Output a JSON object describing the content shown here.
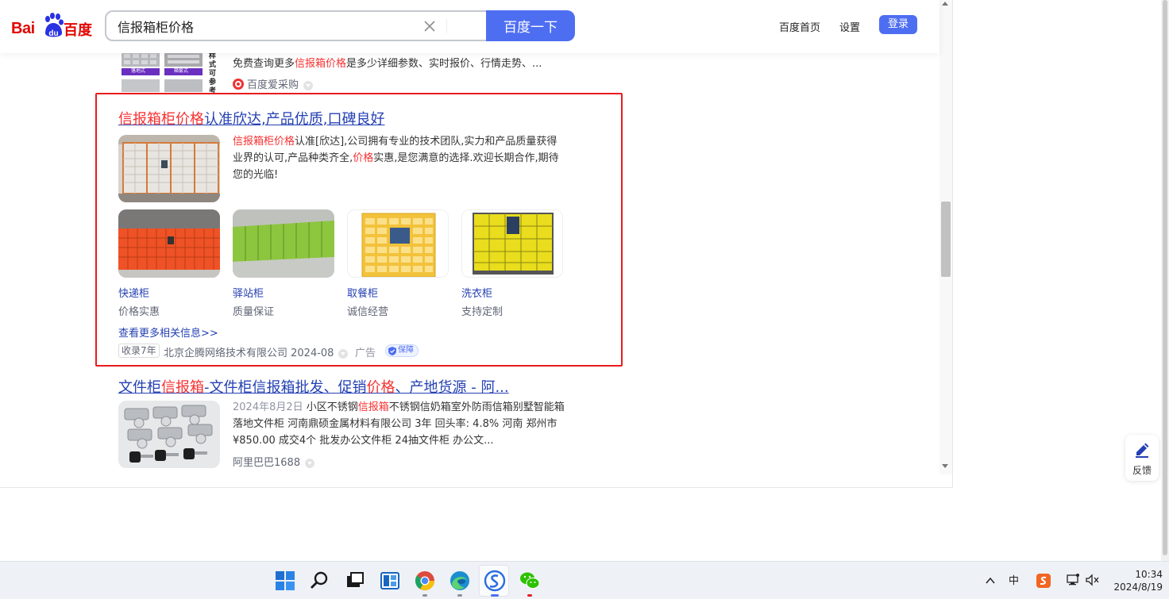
{
  "header": {
    "logo_latin": "Bai",
    "logo_du": "du",
    "logo_cn": "百度",
    "search_value": "信报箱柜价格",
    "search_button": "百度一下",
    "nav_home": "百度首页",
    "nav_settings": "设置",
    "login": "登录"
  },
  "result_top": {
    "desc_pre": "免费查询更多",
    "desc_em": "信报箱价格",
    "desc_post": "是多少详细参数、实时报价、行情走势、...",
    "source": "百度爱采购",
    "thumb_labels": [
      "落地式",
      "箱套式"
    ],
    "vertical_text": "样式可参考"
  },
  "ad": {
    "title_em": "信报箱柜价格",
    "title_rest": "认准欣达,产品优质,口碑良好",
    "desc_em1": "信报箱柜价格",
    "desc_1": "认准[欣达],公司拥有专业的技术团队,实力和产品质量获得",
    "desc_2": "业界的认可,产品种类齐全,",
    "desc_em2": "价格",
    "desc_3": "实惠,是您满意的选择.欢迎长期合作,期待",
    "desc_4": "您的光临!",
    "items": [
      {
        "title": "快递柜",
        "desc": "价格实惠"
      },
      {
        "title": "驿站柜",
        "desc": "质量保证"
      },
      {
        "title": "取餐柜",
        "desc": "诚信经营"
      },
      {
        "title": "洗衣柜",
        "desc": "支持定制"
      }
    ],
    "more": "查看更多相关信息>>",
    "years_tag": "收录7年",
    "company": "北京企腾网络技术有限公司 2024-08",
    "ad_label": "广告",
    "bao_label": "保障"
  },
  "result_bottom": {
    "title_1": "文件柜",
    "title_em1": "信报箱",
    "title_2": "-文件柜信报箱批发、促销",
    "title_em2": "价格",
    "title_3": "、产地货源 - 阿...",
    "date": "2024年8月2日",
    "desc_1": " 小区不锈钢",
    "desc_em": "信报箱",
    "desc_2": "不锈钢信奶箱室外防雨信箱别墅智能箱",
    "desc_line2": "落地文件柜 河南鼎硕金属材料有限公司 3年 回头率: 4.8% 河南 郑州市",
    "desc_line3": "¥850.00 成交4个 批发办公文件柜 24抽文件柜 办公文...",
    "source": "阿里巴巴1688"
  },
  "feedback": {
    "label": "反馈"
  },
  "taskbar": {
    "ime": "中",
    "time": "10:34",
    "date": "2024/8/19"
  },
  "colors": {
    "baidu_blue": "#4e6ef2",
    "link_blue": "#2440b3",
    "highlight_red": "#f73131",
    "ad_border": "#e81c1c"
  }
}
